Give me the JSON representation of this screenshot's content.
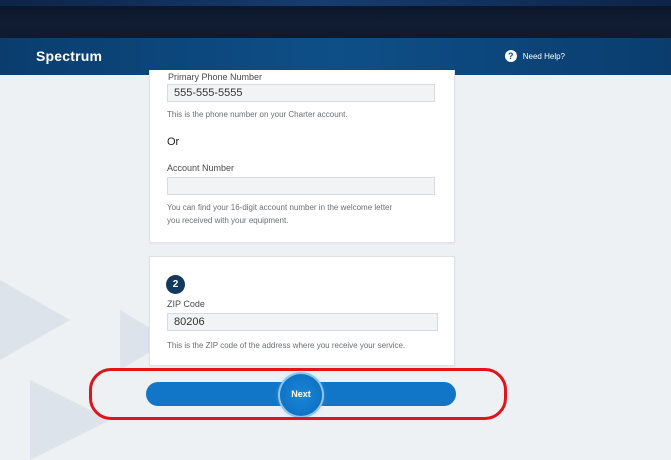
{
  "header": {
    "logo": "Spectrum",
    "help_icon": "question-circle-icon",
    "help_label": "Need Help?"
  },
  "card1": {
    "phone_label": "Primary Phone Number",
    "phone_value": "555-555-5555",
    "phone_hint": "This is the phone number on your Charter account.",
    "or_label": "Or",
    "account_label": "Account Number",
    "account_value": "",
    "account_hint_line1": "You can find your 16-digit account number in the welcome letter",
    "account_hint_line2": "you received with your equipment."
  },
  "card2": {
    "step_number": "2",
    "zip_label": "ZIP Code",
    "zip_value": "80206",
    "zip_hint": "This is the ZIP code of the address where you receive your service."
  },
  "next_button": {
    "label": "Next"
  },
  "colors": {
    "header": "#0e4f88",
    "button": "#1176c8",
    "highlight": "#e0141b",
    "step_badge": "#123a5e"
  }
}
